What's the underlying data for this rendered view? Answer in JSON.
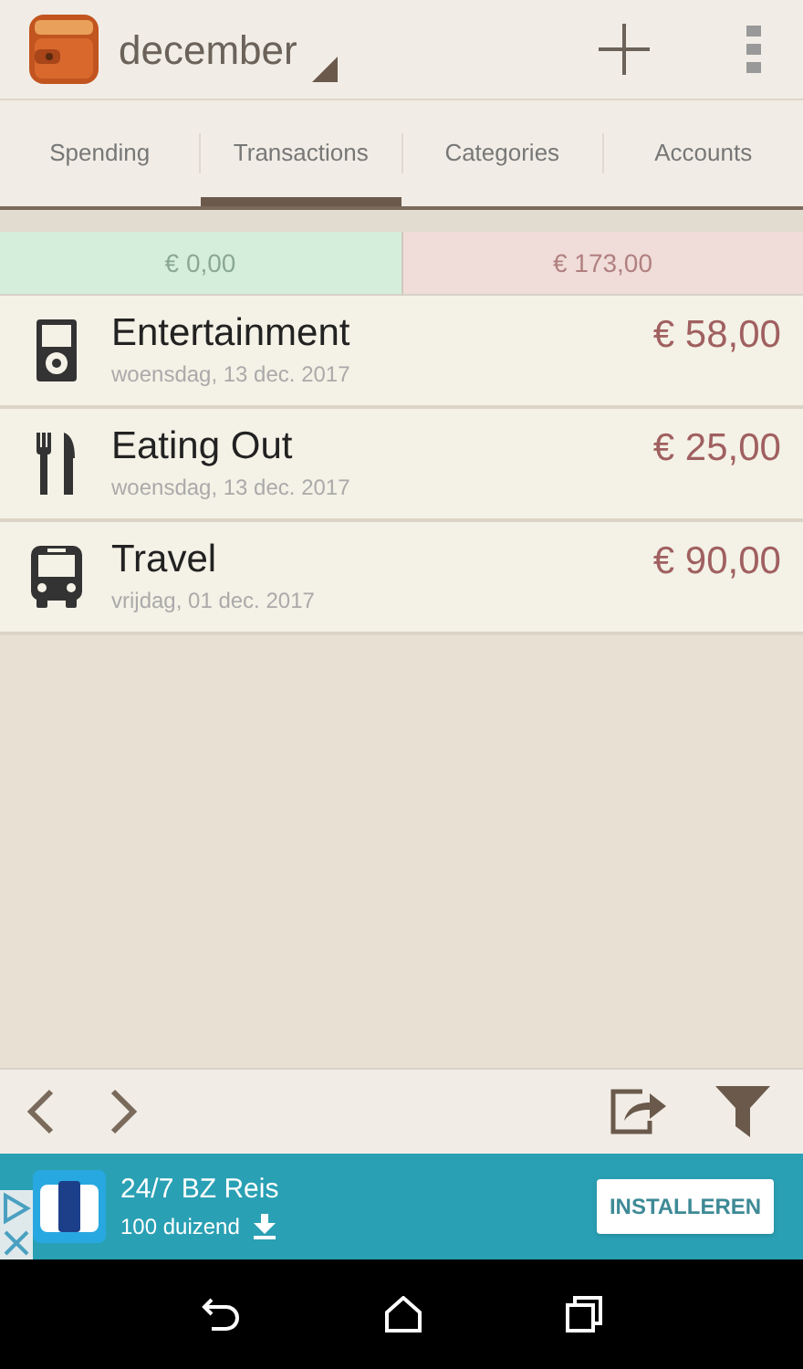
{
  "header": {
    "title": "december"
  },
  "tabs": [
    {
      "label": "Spending",
      "selected": false
    },
    {
      "label": "Transactions",
      "selected": true
    },
    {
      "label": "Categories",
      "selected": false
    },
    {
      "label": "Accounts",
      "selected": false
    }
  ],
  "summary": {
    "income": "€ 0,00",
    "expense": "€ 173,00"
  },
  "transactions": [
    {
      "category": "Entertainment",
      "date": "woensdag, 13 dec. 2017",
      "amount": "€ 58,00"
    },
    {
      "category": "Eating Out",
      "date": "woensdag, 13 dec. 2017",
      "amount": "€ 25,00"
    },
    {
      "category": "Travel",
      "date": "vrijdag, 01 dec. 2017",
      "amount": "€ 90,00"
    }
  ],
  "ad": {
    "title": "24/7 BZ Reis",
    "downloads": "100 duizend",
    "button": "INSTALLEREN"
  }
}
